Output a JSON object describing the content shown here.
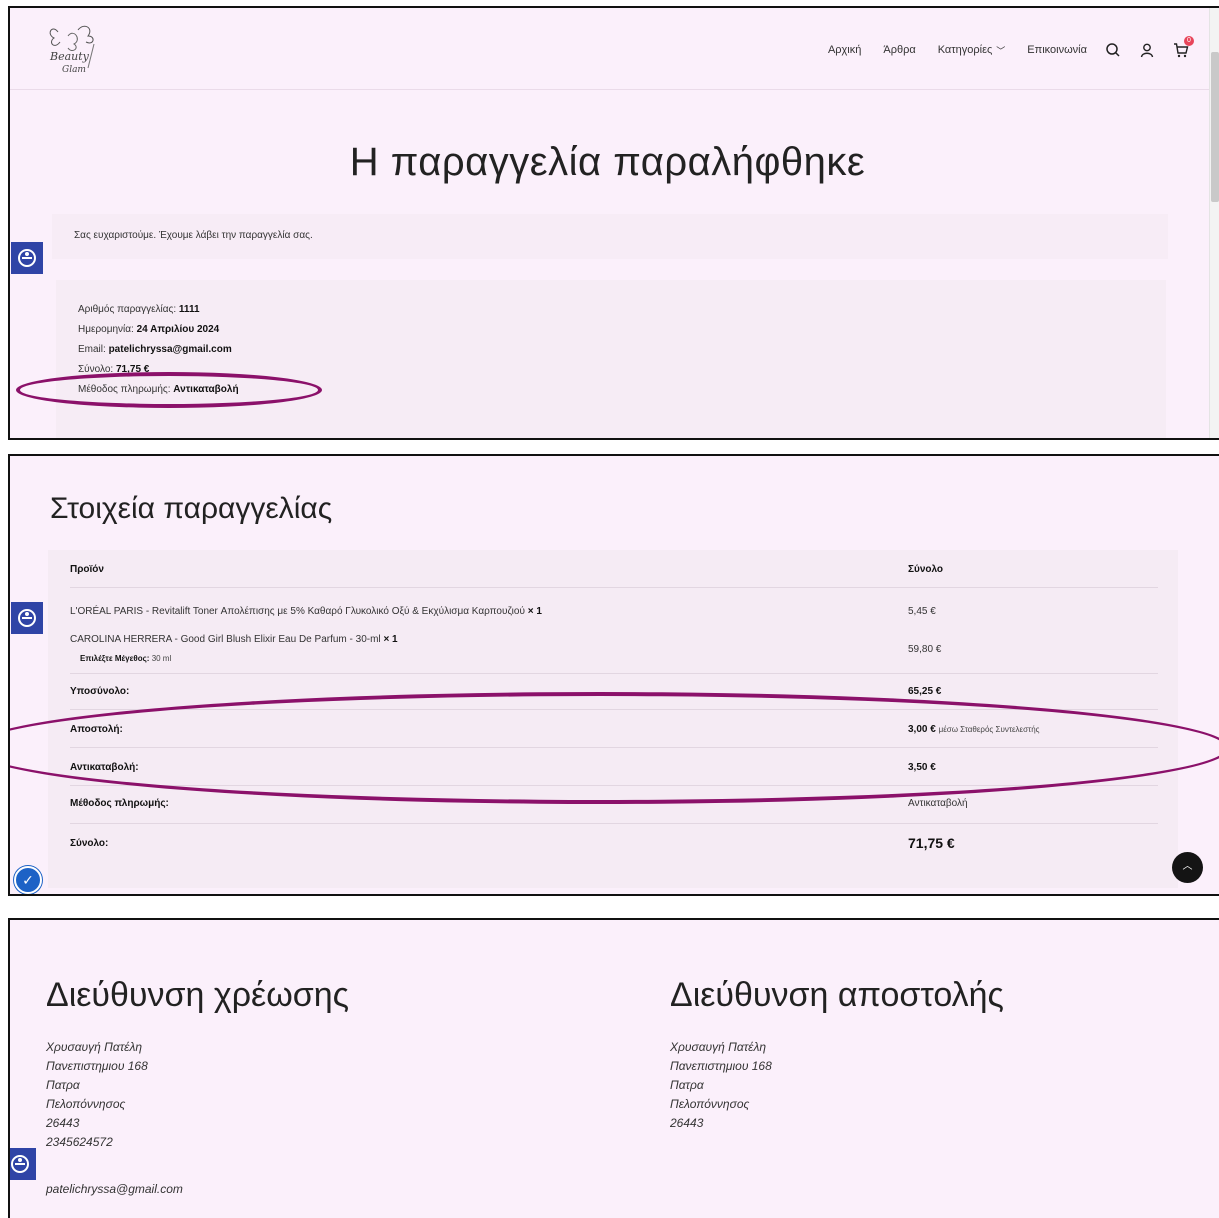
{
  "nav": {
    "items": [
      "Αρχική",
      "Άρθρα",
      "Κατηγορίες",
      "Επικοινωνία"
    ],
    "cart_count": "0"
  },
  "icons": {
    "logo": "beauty-logo",
    "search": "search-icon",
    "account": "user-icon",
    "cart": "cart-icon",
    "accessibility": "accessibility-icon",
    "scroll_top": "chevron-up-icon",
    "cookie": "cookie-settings-icon"
  },
  "colors": {
    "page_bg": "#fbf0fb",
    "highlight_ring": "#8b116a",
    "accessibility_btn": "#2f44a6"
  },
  "received": {
    "title": "Η παραγγελία παραλήφθηκε",
    "thanks": "Σας ευχαριστούμε. Έχουμε λάβει την παραγγελία σας."
  },
  "overview": {
    "order_label": "Αριθμός παραγγελίας:",
    "order_value": "1111",
    "date_label": "Ημερομηνία:",
    "date_value": "24 Απριλίου 2024",
    "email_label": "Email:",
    "email_value": "patelichryssa@gmail.com",
    "total_label": "Σύνολο:",
    "total_value": "71,75 €",
    "method_label": "Μέθοδος πληρωμής:",
    "method_value": "Αντικαταβολή"
  },
  "details": {
    "title": "Στοιχεία παραγγελίας",
    "col_product": "Προϊόν",
    "col_total": "Σύνολο",
    "items": [
      {
        "name": "L'ORÉAL PARIS - Revitalift Toner Απολέπισης με 5% Καθαρό Γλυκολικό Οξύ & Εκχύλισμα Καρπουζιού",
        "qty": "× 1",
        "total": "5,45 €"
      },
      {
        "name": "CAROLINA HERRERA - Good Girl Blush Elixir Eau De Parfum - 30-ml",
        "qty": "× 1",
        "total": "59,80 €",
        "meta_label": "Επιλέξτε Μέγεθος:",
        "meta_value": "30 ml"
      }
    ],
    "subtotal_label": "Υποσύνολο:",
    "subtotal_value": "65,25 €",
    "shipping_label": "Αποστολή:",
    "shipping_value": "3,00 €",
    "shipping_note": "μέσω Σταθερός Συντελεστής",
    "cod_label": "Αντικαταβολή:",
    "cod_value": "3,50 €",
    "method_label": "Μέθοδος πληρωμής:",
    "method_value": "Αντικαταβολή",
    "total_label": "Σύνολο:",
    "total_value": "71,75 €"
  },
  "billing": {
    "title": "Διεύθυνση χρέωσης",
    "lines": [
      "Χρυσαυγή Πατέλη",
      "Πανεπιστημιου 168",
      "Πατρα",
      "Πελοπόννησος",
      "26443",
      "2345624572"
    ],
    "email": "patelichryssa@gmail.com"
  },
  "shipping": {
    "title": "Διεύθυνση αποστολής",
    "lines": [
      "Χρυσαυγή Πατέλη",
      "Πανεπιστημιου 168",
      "Πατρα",
      "Πελοπόννησος",
      "26443"
    ]
  }
}
